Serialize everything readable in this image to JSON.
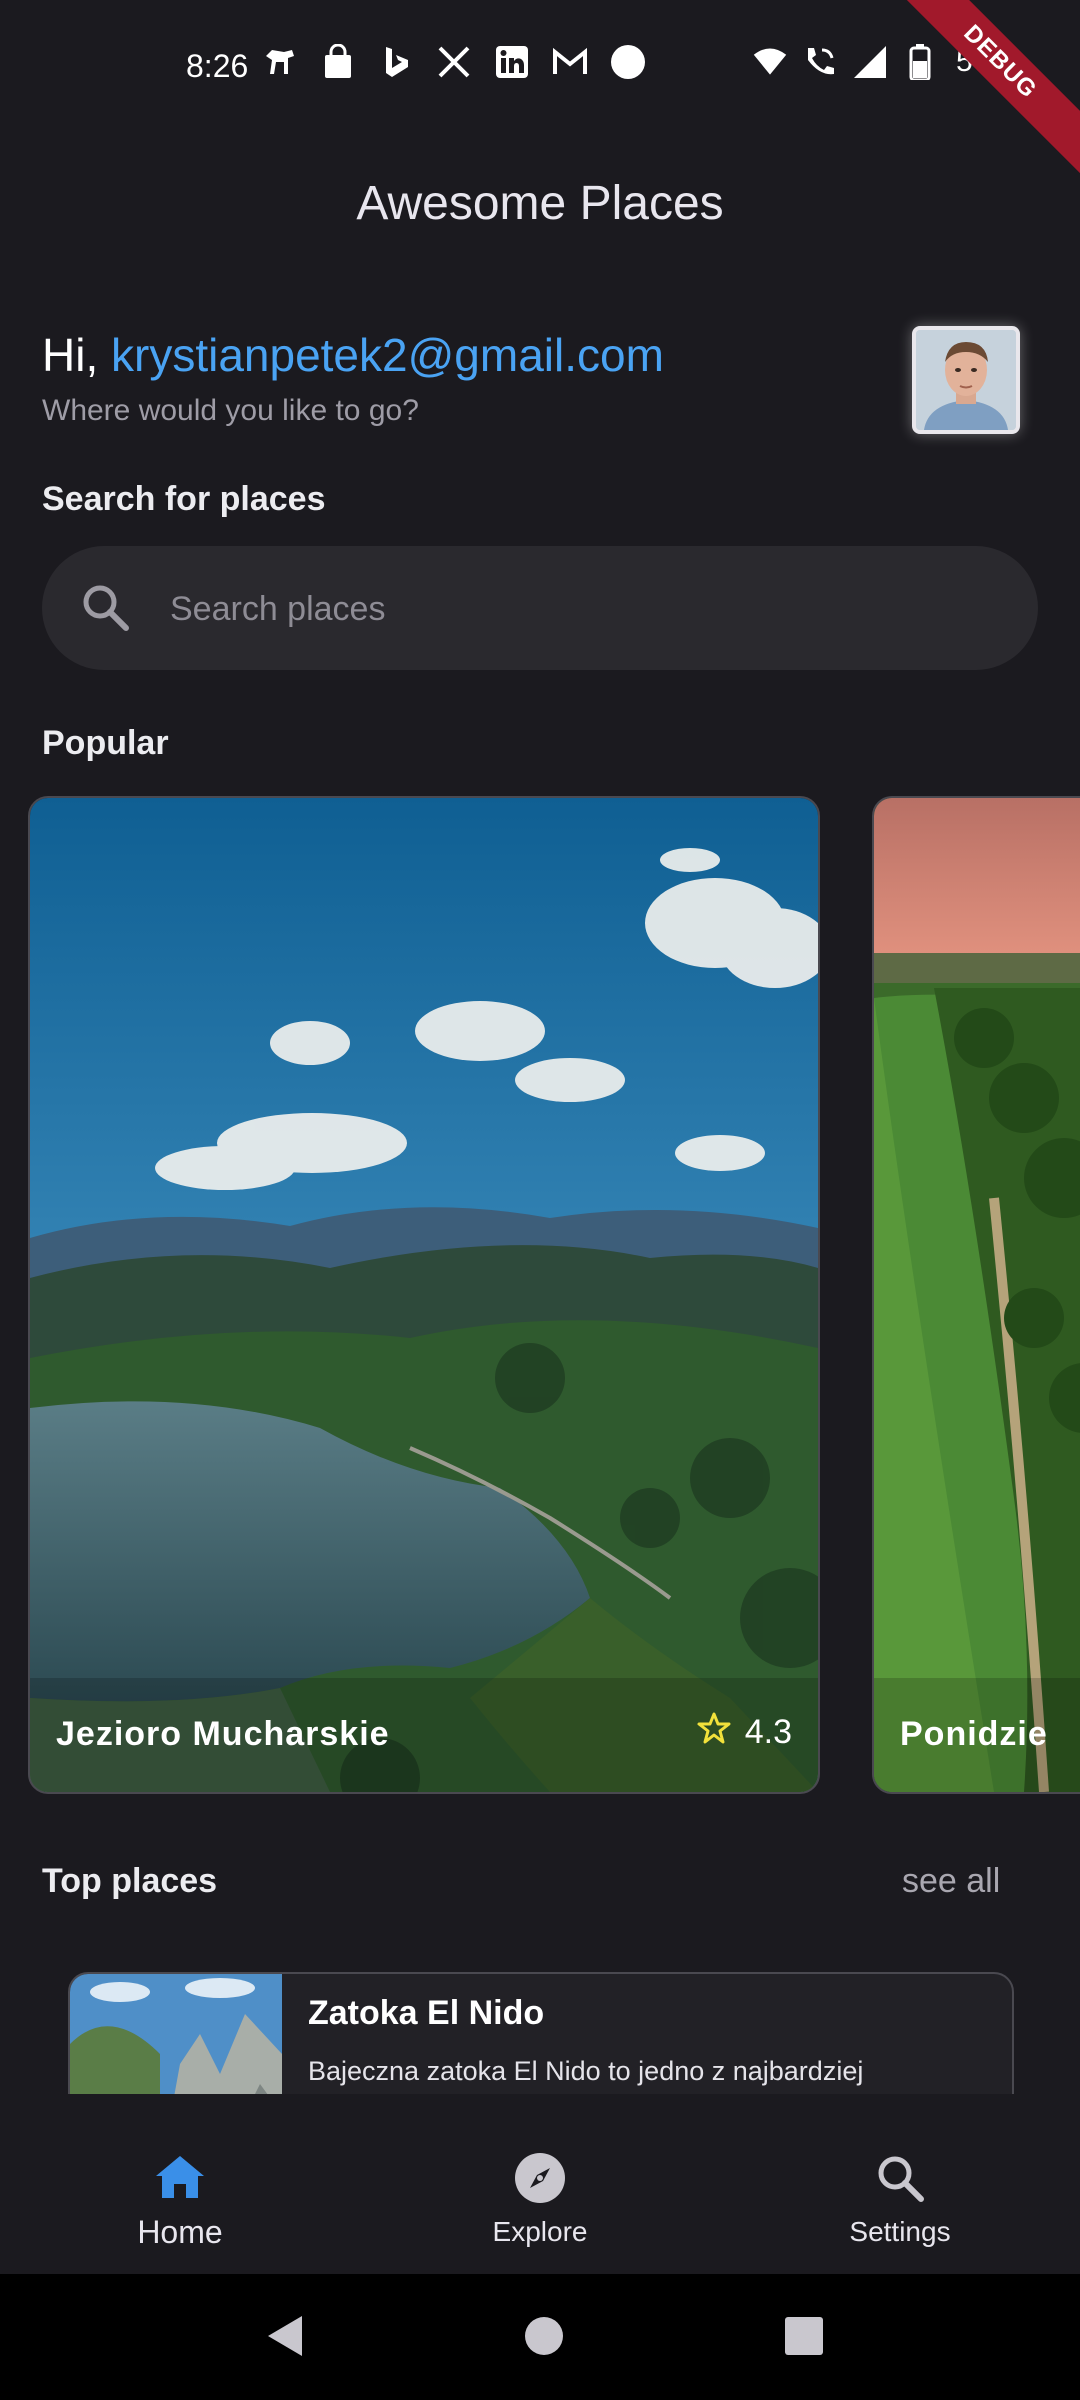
{
  "status_bar": {
    "time": "8:26",
    "battery_percent": "57%",
    "notification_icons": [
      "pet-icon",
      "shopping-bag-icon",
      "bing-icon",
      "x-icon",
      "linkedin-icon",
      "gmail-icon",
      "circle-icon"
    ],
    "system_icons": [
      "wifi-icon",
      "wifi-call-icon",
      "signal-icon",
      "battery-icon"
    ]
  },
  "debug_banner": "DEBUG",
  "app_bar": {
    "title": "Awesome Places"
  },
  "greeting": {
    "hi": "Hi, ",
    "email": "krystianpetek2@gmail.com",
    "subtitle": "Where would you like to go?"
  },
  "search": {
    "section_title": "Search for places",
    "placeholder": "Search places",
    "value": ""
  },
  "popular": {
    "section_title": "Popular",
    "cards": [
      {
        "title": "Jezioro Mucharskie",
        "rating": "4.3"
      },
      {
        "title": "Ponidzie"
      }
    ]
  },
  "top_places": {
    "section_title": "Top places",
    "see_all": "see all",
    "items": [
      {
        "title": "Zatoka El Nido",
        "description": "Bajeczna zatoka El Nido to jedno z najbardziej"
      }
    ]
  },
  "bottom_nav": {
    "items": [
      {
        "label": "Home",
        "icon": "home-icon",
        "active": true
      },
      {
        "label": "Explore",
        "icon": "compass-icon",
        "active": false
      },
      {
        "label": "Settings",
        "icon": "search-icon",
        "active": false
      }
    ]
  },
  "colors": {
    "background": "#1b1a1f",
    "accent": "#4aa3f3",
    "surface": "#2a292e",
    "rating_star": "#f2e13b"
  }
}
